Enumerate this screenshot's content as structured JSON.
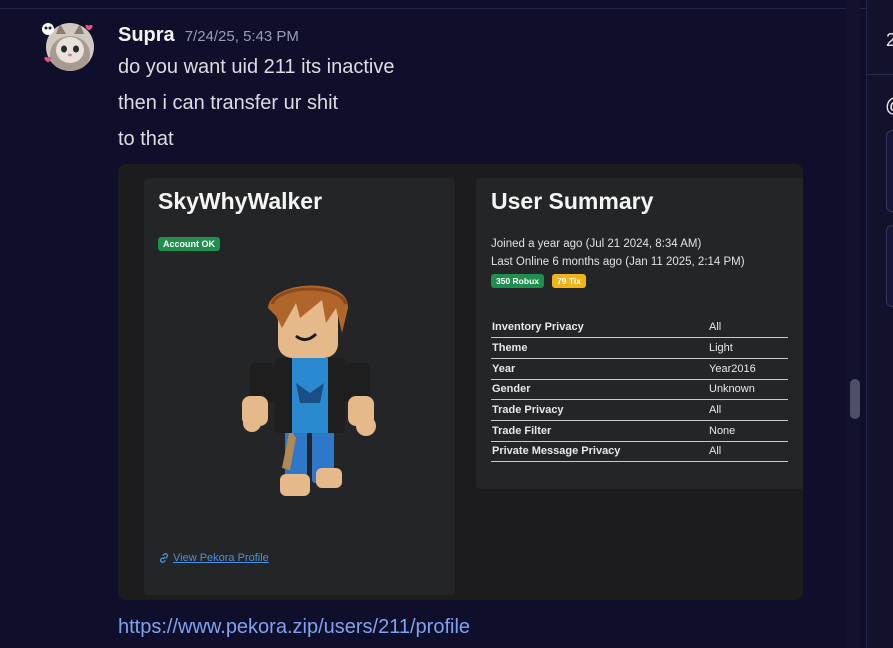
{
  "message": {
    "author": "Supra",
    "timestamp": "7/24/25, 5:43 PM",
    "lines": [
      "do you want uid 211 its inactive",
      "then i can transfer ur shit",
      "to that"
    ],
    "link": "https://www.pekora.zip/users/211/profile"
  },
  "embed": {
    "profile": {
      "username": "SkyWhyWalker",
      "status_badge": "Account OK",
      "view_link": "View Pekora Profile"
    },
    "summary": {
      "title": "User Summary",
      "joined": "Joined a year ago (Jul 21 2024, 8:34 AM)",
      "last_online": "Last Online 6 months ago (Jan 11 2025, 2:14 PM)",
      "robux": "350 Robux",
      "tix": "79 Tix",
      "properties": [
        {
          "key": "Inventory Privacy",
          "value": "All"
        },
        {
          "key": "Theme",
          "value": "Light"
        },
        {
          "key": "Year",
          "value": "Year2016"
        },
        {
          "key": "Gender",
          "value": "Unknown"
        },
        {
          "key": "Trade Privacy",
          "value": "All"
        },
        {
          "key": "Trade Filter",
          "value": "None"
        },
        {
          "key": "Private Message Privacy",
          "value": "All"
        }
      ]
    }
  },
  "right_panel": {
    "char_top": "2",
    "char_mid": "@"
  },
  "colors": {
    "background": "#0f0f2b",
    "success_badge": "#1f8f4d",
    "tix_badge": "#f0b41a",
    "link": "#7fa2f0"
  }
}
